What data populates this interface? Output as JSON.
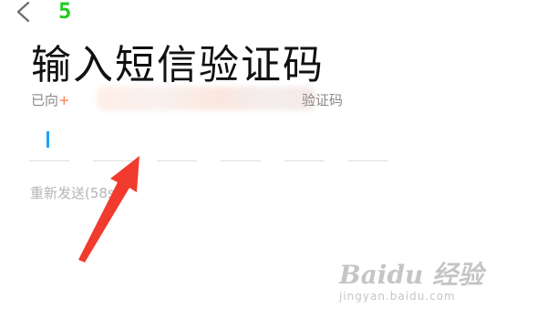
{
  "header": {
    "back_icon": "chevron-left-icon",
    "step_number": "5"
  },
  "main": {
    "title": "输入短信验证码",
    "subtitle_prefix": "已向",
    "subtitle_plus": "+",
    "subtitle_suffix": "验证码",
    "code_cells": [
      "",
      "",
      "",
      "",
      "",
      ""
    ],
    "resend_text": "重新发送(58s)"
  },
  "annotation": {
    "arrow_color": "#f03b2e"
  },
  "watermark": {
    "logo_text": "Baidu 经验",
    "sub_text": "jingyan.baidu.com"
  },
  "colors": {
    "step_number": "#22cc22",
    "caret": "#1e9fff",
    "plus": "#ff7a45"
  }
}
